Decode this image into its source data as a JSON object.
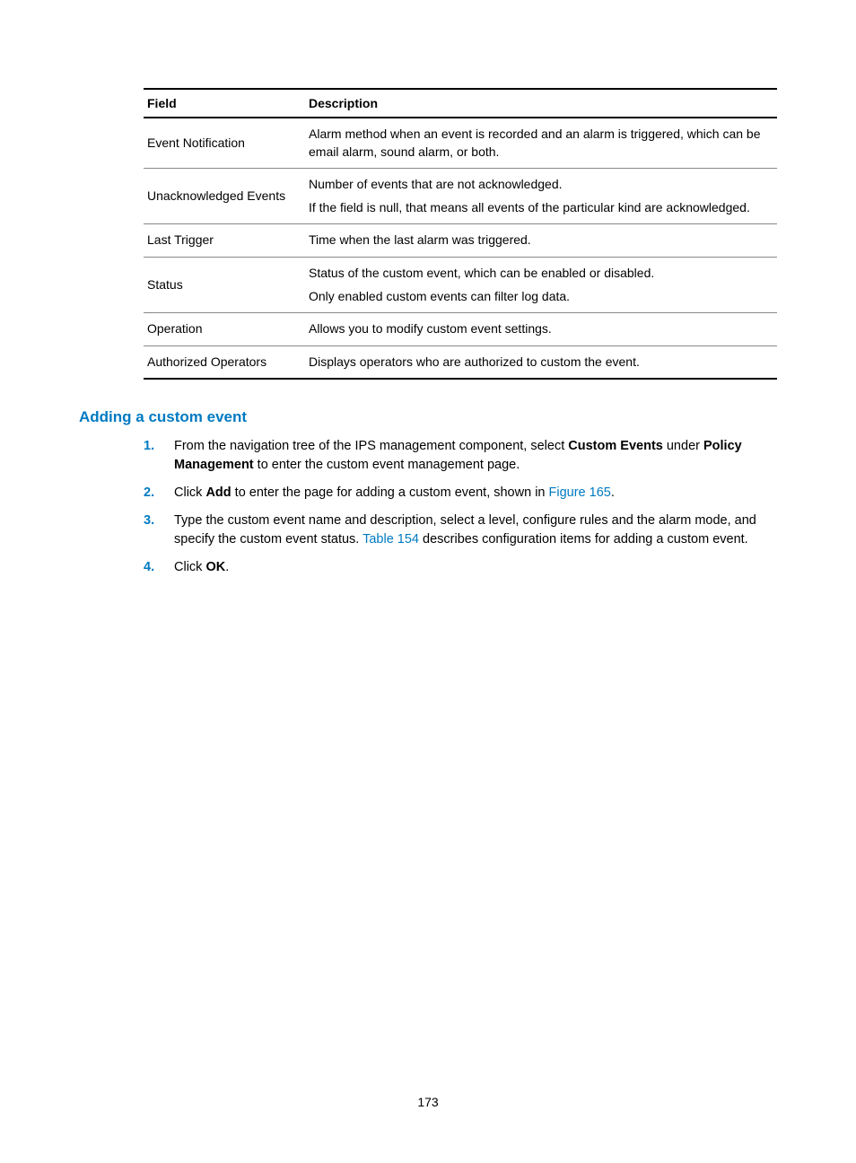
{
  "table": {
    "headers": {
      "field": "Field",
      "description": "Description"
    },
    "rows": [
      {
        "field": "Event Notification",
        "desc": [
          "Alarm method when an event is recorded and an alarm is triggered, which can be email alarm, sound alarm, or both."
        ]
      },
      {
        "field": "Unacknowledged Events",
        "desc": [
          "Number of events that are not acknowledged.",
          "If the field is null, that means all events of the particular kind are acknowledged."
        ]
      },
      {
        "field": "Last Trigger",
        "desc": [
          "Time when the last alarm was triggered."
        ]
      },
      {
        "field": "Status",
        "desc": [
          "Status of the custom event, which can be enabled or disabled.",
          "Only enabled custom events can filter log data."
        ]
      },
      {
        "field": "Operation",
        "desc": [
          "Allows you to modify custom event settings."
        ]
      },
      {
        "field": "Authorized Operators",
        "desc": [
          "Displays operators who are authorized to custom the event."
        ]
      }
    ]
  },
  "section": {
    "heading": "Adding a custom event",
    "step1": {
      "pre": "From the navigation tree of the IPS management component, select ",
      "custom_events": "Custom Events",
      "mid": " under ",
      "policy_management": "Policy Management",
      "post": " to enter the custom event management page."
    },
    "step2": {
      "pre": "Click ",
      "add": "Add",
      "mid": " to enter the page for adding a custom event, shown in ",
      "figure": "Figure 165",
      "post": "."
    },
    "step3": {
      "pre": "Type the custom event name and description, select a level, configure rules and the alarm mode, and specify the custom event status. ",
      "table_ref": "Table 154",
      "post": " describes configuration items for adding a custom event."
    },
    "step4": {
      "pre": "Click ",
      "ok": "OK",
      "post": "."
    }
  },
  "page_number": "173"
}
